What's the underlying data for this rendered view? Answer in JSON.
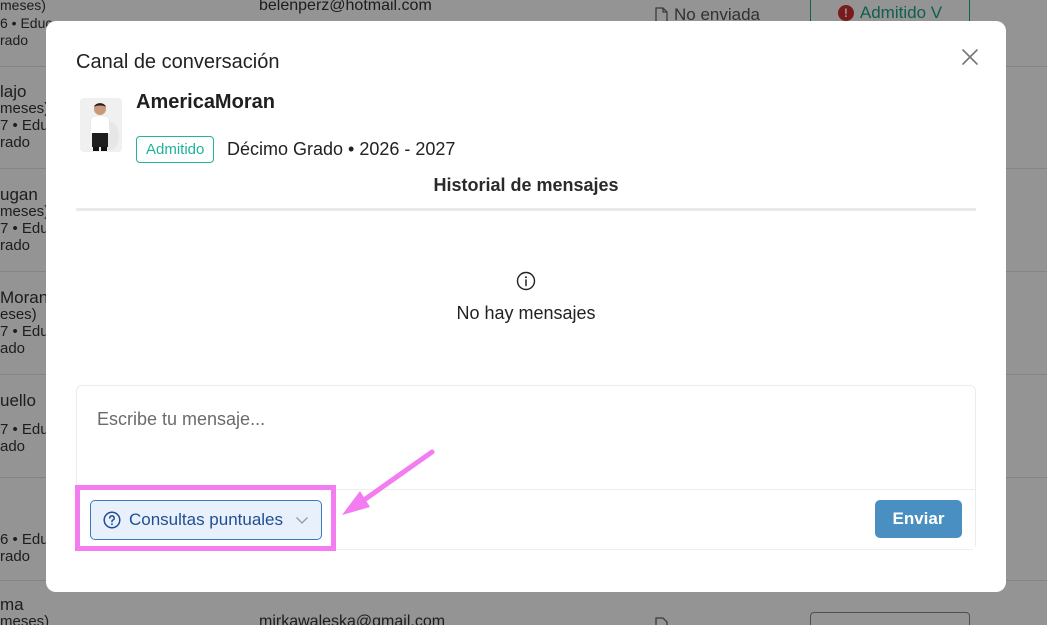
{
  "background": {
    "rows": [
      {
        "left_lines": [
          "meses)",
          "6 • Educ...",
          "rado"
        ],
        "email": "belenperz@hotmail.com",
        "status": "No enviada",
        "button": "Admitido V"
      },
      {
        "left_lines": [
          "lajo",
          "meses)",
          "7 • Educ",
          "rado"
        ]
      },
      {
        "left_lines": [
          "ugan",
          "meses)",
          "7 • Educ",
          "rado"
        ]
      },
      {
        "left_lines": [
          "Moran",
          "eses)",
          "7 • Educ",
          "ado"
        ]
      },
      {
        "left_lines": [
          "uello",
          "7 • Educ",
          "ado"
        ]
      },
      {
        "left_lines": [
          "6 • Educ",
          "rado"
        ]
      },
      {
        "left_lines": [
          "ma",
          "meses)"
        ],
        "email": "mirkawaleska@gmail.com"
      }
    ]
  },
  "modal": {
    "title": "Canal de conversación",
    "student": {
      "name": "AmericaMoran",
      "badge": "Admitido",
      "grade": "Décimo Grado • 2026 - 2027"
    },
    "history_title": "Historial de mensajes",
    "empty_text": "No hay mensajes",
    "composer": {
      "placeholder": "Escribe tu mensaje...",
      "category": "Consultas puntuales",
      "send_label": "Enviar"
    }
  },
  "colors": {
    "accent": "#4a8fc1",
    "badge": "#1fb39a",
    "category_border": "#3a7bbf",
    "category_bg": "#e8f0fb",
    "annotation": "#f27cf0"
  },
  "icons": {
    "close": "close-icon",
    "empty": "info-icon",
    "category": "help-circle-icon",
    "dropdown": "chevron-down-icon",
    "background_status": "document-icon",
    "background_badge": "alert-icon"
  }
}
